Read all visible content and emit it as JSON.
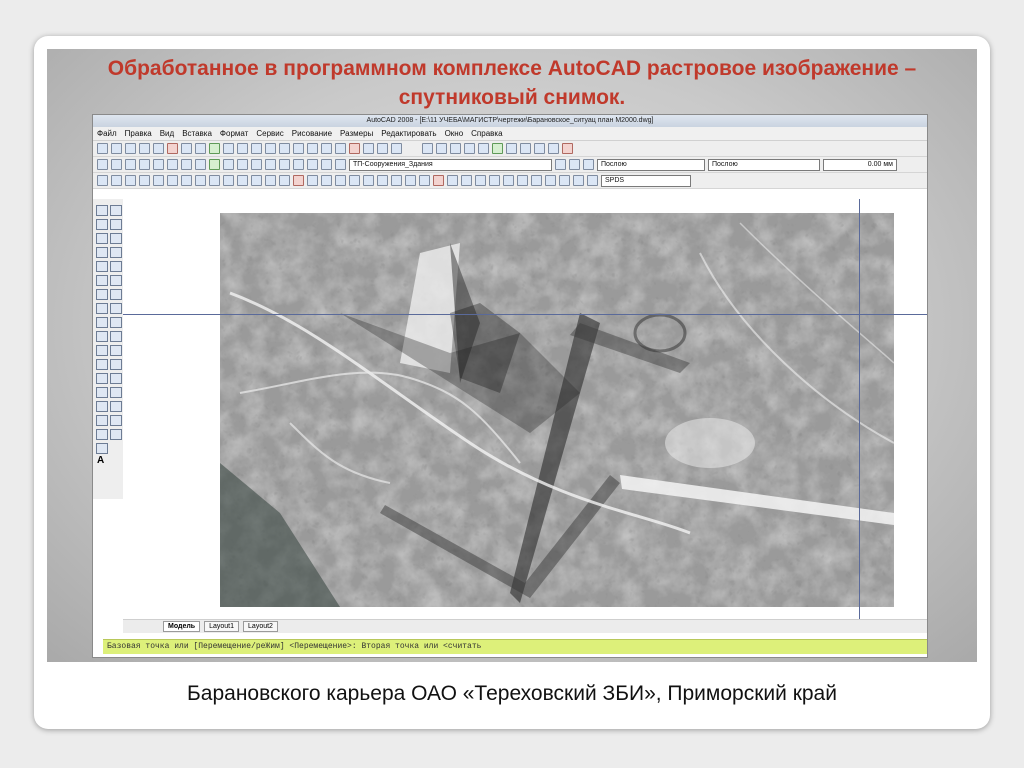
{
  "slide": {
    "title": "Обработанное в программном комплексе  AutoCAD растровое изображение – спутниковый снимок.",
    "caption": "Барановского карьера ОАО «Тереховский ЗБИ», Приморский край"
  },
  "app": {
    "window_title": "AutoCAD 2008 - [E:\\11 УЧЕБА\\МАГИСТР\\чертежи\\Барановское_ситуац план М2000.dwg]",
    "menu": [
      "Файл",
      "Правка",
      "Вид",
      "Вставка",
      "Формат",
      "Сервис",
      "Рисование",
      "Размеры",
      "Редактировать",
      "Окно",
      "Справка"
    ],
    "layer_combo": "ТП-Сооружения_Здания",
    "color_combo": "Послою",
    "linetype_combo": "Послою",
    "lineweight_combo": "0.00 мм",
    "style_combo": "SPDS",
    "tabs": [
      "Модель",
      "Layout1",
      "Layout2"
    ],
    "command_line": "Базовая точка или [Перемещение/реЖим] <Перемещение>: Вторая точка или <считать"
  },
  "colors": {
    "title_red": "#c0392b",
    "command_bg": "#ddf07a",
    "crosshair": "#5a6a9a"
  }
}
